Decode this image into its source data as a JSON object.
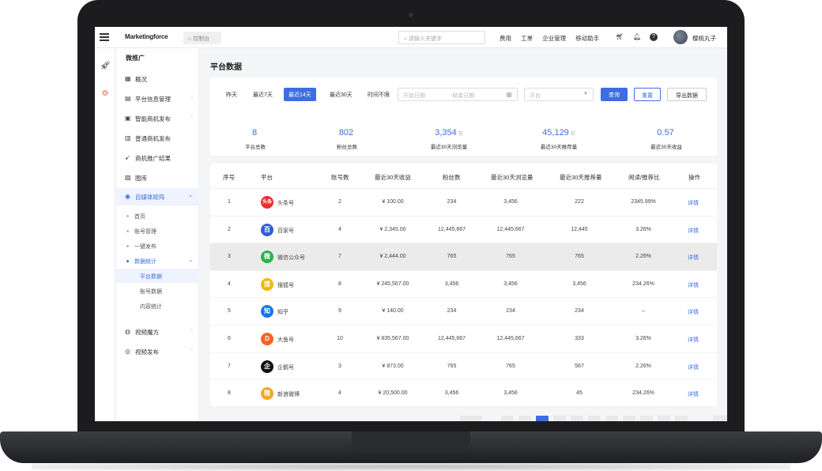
{
  "app": {
    "logo": "Marketingforce",
    "breadcrumb": "控制台",
    "search_placeholder": "请输入关键字",
    "top_nav": [
      "费用",
      "工单",
      "企业管理",
      "移动助手"
    ],
    "username": "樱桃丸子"
  },
  "sidebar": {
    "title": "微推广",
    "items": [
      {
        "label": "概况",
        "icon": "overview-icon"
      },
      {
        "label": "平台信息管理",
        "icon": "platform-icon"
      },
      {
        "label": "智能商机发布",
        "icon": "smart-publish-icon"
      },
      {
        "label": "普通商机发布",
        "icon": "normal-publish-icon"
      },
      {
        "label": "商机推广结果",
        "icon": "result-icon"
      },
      {
        "label": "图库",
        "icon": "gallery-icon"
      },
      {
        "label": "自媒体矩阵",
        "icon": "media-matrix-icon"
      }
    ],
    "sub_items": [
      "首页",
      "账号管理",
      "一键发布",
      "数据统计"
    ],
    "sub_sub_items": [
      "平台数据",
      "账号数据",
      "内容统计"
    ],
    "bottom_items": [
      {
        "label": "视频魔方",
        "icon": "video-cube-icon"
      },
      {
        "label": "视频发布",
        "icon": "video-publish-icon"
      }
    ]
  },
  "page": {
    "title": "平台数据",
    "filters": {
      "quick": [
        "昨天",
        "最近7天",
        "最近14天",
        "最近30天",
        "时间不限"
      ],
      "selected": "最近14天",
      "start_placeholder": "开始日期",
      "end_placeholder": "结束日期",
      "separator": "-",
      "platform_placeholder": "平台",
      "query_label": "查询",
      "reset_label": "重置",
      "export_label": "导出数据"
    },
    "stats": [
      {
        "value": "8",
        "unit": "",
        "label": "平台总数"
      },
      {
        "value": "802",
        "unit": "",
        "label": "粉丝总数"
      },
      {
        "value": "3,354",
        "unit": "万",
        "label": "最近30天浏览量"
      },
      {
        "value": "45,129",
        "unit": "亿",
        "label": "最近30天推荐量"
      },
      {
        "value": "0.57",
        "unit": "",
        "label": "最近30天收益"
      }
    ],
    "table": {
      "headers": [
        "序号",
        "平台",
        "账号数",
        "最近30天收益",
        "粉丝数",
        "最近30天浏览量",
        "最近30天推荐量",
        "阅读/推荐比",
        "操作"
      ],
      "action_label": "详情",
      "rows": [
        {
          "no": "1",
          "platform": "头条号",
          "logo": "头条",
          "logo_color": "#e8302c",
          "accounts": "2",
          "income": "¥ 100.00",
          "fans": "234",
          "views": "3,456",
          "recommends": "222",
          "ratio": "2345.99%"
        },
        {
          "no": "2",
          "platform": "百家号",
          "logo": "百",
          "logo_color": "#2f5fd0",
          "accounts": "4",
          "income": "¥ 2,345.00",
          "fans": "12,445,667",
          "views": "12,445,667",
          "recommends": "12,445",
          "ratio": "3.26%"
        },
        {
          "no": "3",
          "platform": "微信公众号",
          "logo": "微",
          "logo_color": "#2bb24c",
          "accounts": "7",
          "income": "¥ 2,444.00",
          "fans": "765",
          "views": "765",
          "recommends": "765",
          "ratio": "2.26%"
        },
        {
          "no": "4",
          "platform": "搜狐号",
          "logo": "搜",
          "logo_color": "#f2b705",
          "accounts": "8",
          "income": "¥ 245,567.00",
          "fans": "3,456",
          "views": "3,456",
          "recommends": "3,456",
          "ratio": "234.26%"
        },
        {
          "no": "5",
          "platform": "知乎",
          "logo": "知",
          "logo_color": "#1772f6",
          "accounts": "9",
          "income": "¥ 140.00",
          "fans": "234",
          "views": "234",
          "recommends": "234",
          "ratio": "–"
        },
        {
          "no": "6",
          "platform": "大鱼号",
          "logo": "D",
          "logo_color": "#f26522",
          "accounts": "10",
          "income": "¥ 835,567.00",
          "fans": "12,445,667",
          "views": "12,445,667",
          "recommends": "333",
          "ratio": "3.26%"
        },
        {
          "no": "7",
          "platform": "企鹅号",
          "logo": "企",
          "logo_color": "#111111",
          "accounts": "3",
          "income": "¥ 873.00",
          "fans": "765",
          "views": "765",
          "recommends": "567",
          "ratio": "2.26%"
        },
        {
          "no": "8",
          "platform": "新浪微博",
          "logo": "微",
          "logo_color": "#f5a623",
          "accounts": "4",
          "income": "¥ 20,500.00",
          "fans": "3,456",
          "views": "3,456",
          "recommends": "45",
          "ratio": "234.26%"
        }
      ]
    }
  },
  "colors": {
    "accent": "#3c6ee0",
    "background": "#f4f5f7"
  }
}
